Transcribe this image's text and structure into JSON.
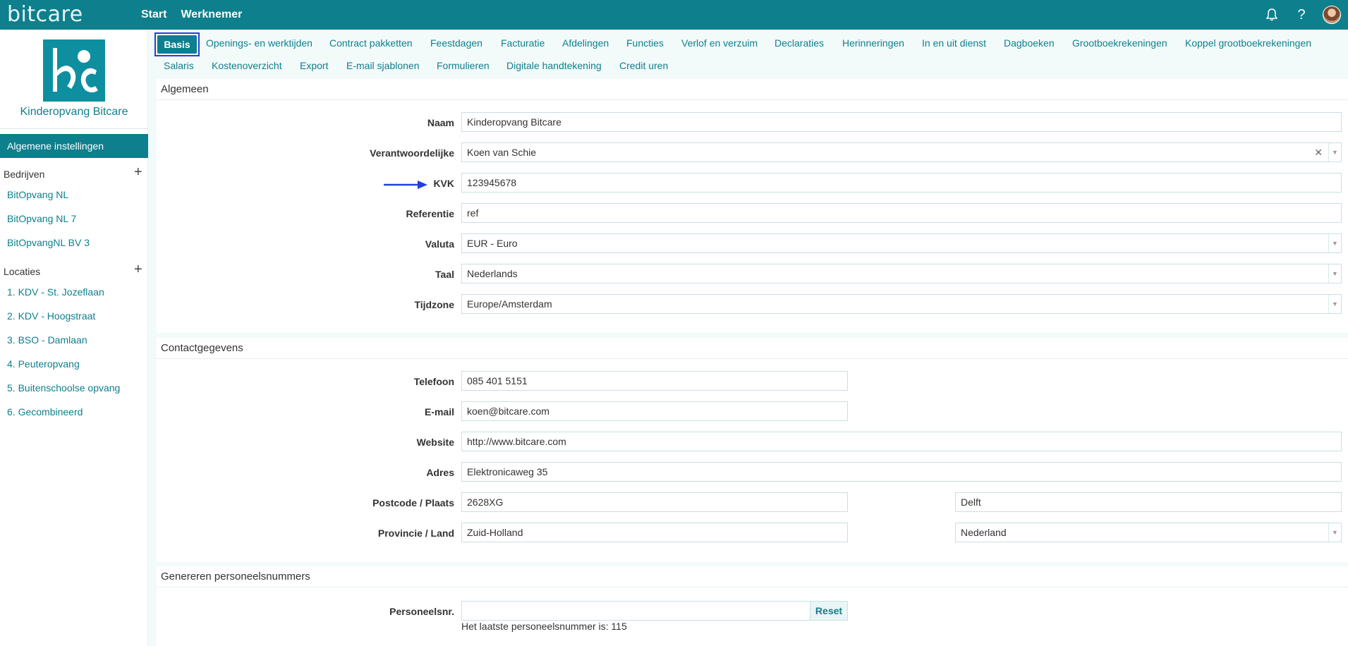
{
  "app": {
    "brand": "bitcare",
    "nav": [
      "Start",
      "Werknemer"
    ]
  },
  "icons": {
    "notifications": "bell-icon",
    "help": "help-icon",
    "avatar": "user-avatar"
  },
  "colors": {
    "primary": "#0e7f8c",
    "highlight_border": "#2340d8",
    "arrow": "#2340d8",
    "tab_background": "#f3fafa"
  },
  "sidebar": {
    "org_name": "Kinderopvang Bitcare",
    "active_item": "Algemene instellingen",
    "companies_title": "Bedrijven",
    "companies": [
      "BitOpvang NL",
      "BitOpvang NL 7",
      "BitOpvangNL BV 3"
    ],
    "locations_title": "Locaties",
    "locations": [
      "1. KDV - St. Jozeflaan",
      "2. KDV - Hoogstraat",
      "3. BSO - Damlaan",
      "4. Peuteropvang",
      "5. Buitenschoolse opvang",
      "6. Gecombineerd"
    ]
  },
  "tabs": {
    "active": "Basis",
    "row1": [
      "Openings- en werktijden",
      "Contract pakketten",
      "Feestdagen",
      "Facturatie",
      "Afdelingen",
      "Functies",
      "Verlof en verzuim",
      "Declaraties",
      "Herinneringen",
      "In en uit dienst",
      "Dagboeken",
      "Grootboekrekeningen",
      "Koppel grootboekrekeningen"
    ],
    "row2": [
      "Salaris",
      "Kostenoverzicht",
      "Export",
      "E-mail sjablonen",
      "Formulieren",
      "Digitale handtekening",
      "Credit uren"
    ]
  },
  "general": {
    "title": "Algemeen",
    "naam_label": "Naam",
    "naam_value": "Kinderopvang Bitcare",
    "verantwoordelijke_label": "Verantwoordelijke",
    "verantwoordelijke_value": "Koen van Schie",
    "kvk_label": "KVK",
    "kvk_value": "123945678",
    "referentie_label": "Referentie",
    "referentie_value": "ref",
    "valuta_label": "Valuta",
    "valuta_value": "EUR - Euro",
    "taal_label": "Taal",
    "taal_value": "Nederlands",
    "tijdzone_label": "Tijdzone",
    "tijdzone_value": "Europe/Amsterdam"
  },
  "contact": {
    "title": "Contactgegevens",
    "telefoon_label": "Telefoon",
    "telefoon_value": "085 401 5151",
    "email_label": "E-mail",
    "email_value": "koen@bitcare.com",
    "website_label": "Website",
    "website_value": "http://www.bitcare.com",
    "adres_label": "Adres",
    "adres_value": "Elektronicaweg 35",
    "postcode_plaats_label": "Postcode / Plaats",
    "postcode_value": "2628XG",
    "plaats_value": "Delft",
    "provincie_land_label": "Provincie / Land",
    "provincie_value": "Zuid-Holland",
    "land_value": "Nederland"
  },
  "personnel": {
    "title": "Genereren personeelsnummers",
    "label": "Personeelsnr.",
    "value": "",
    "reset_label": "Reset",
    "hint": "Het laatste personeelsnummer is: 115"
  }
}
